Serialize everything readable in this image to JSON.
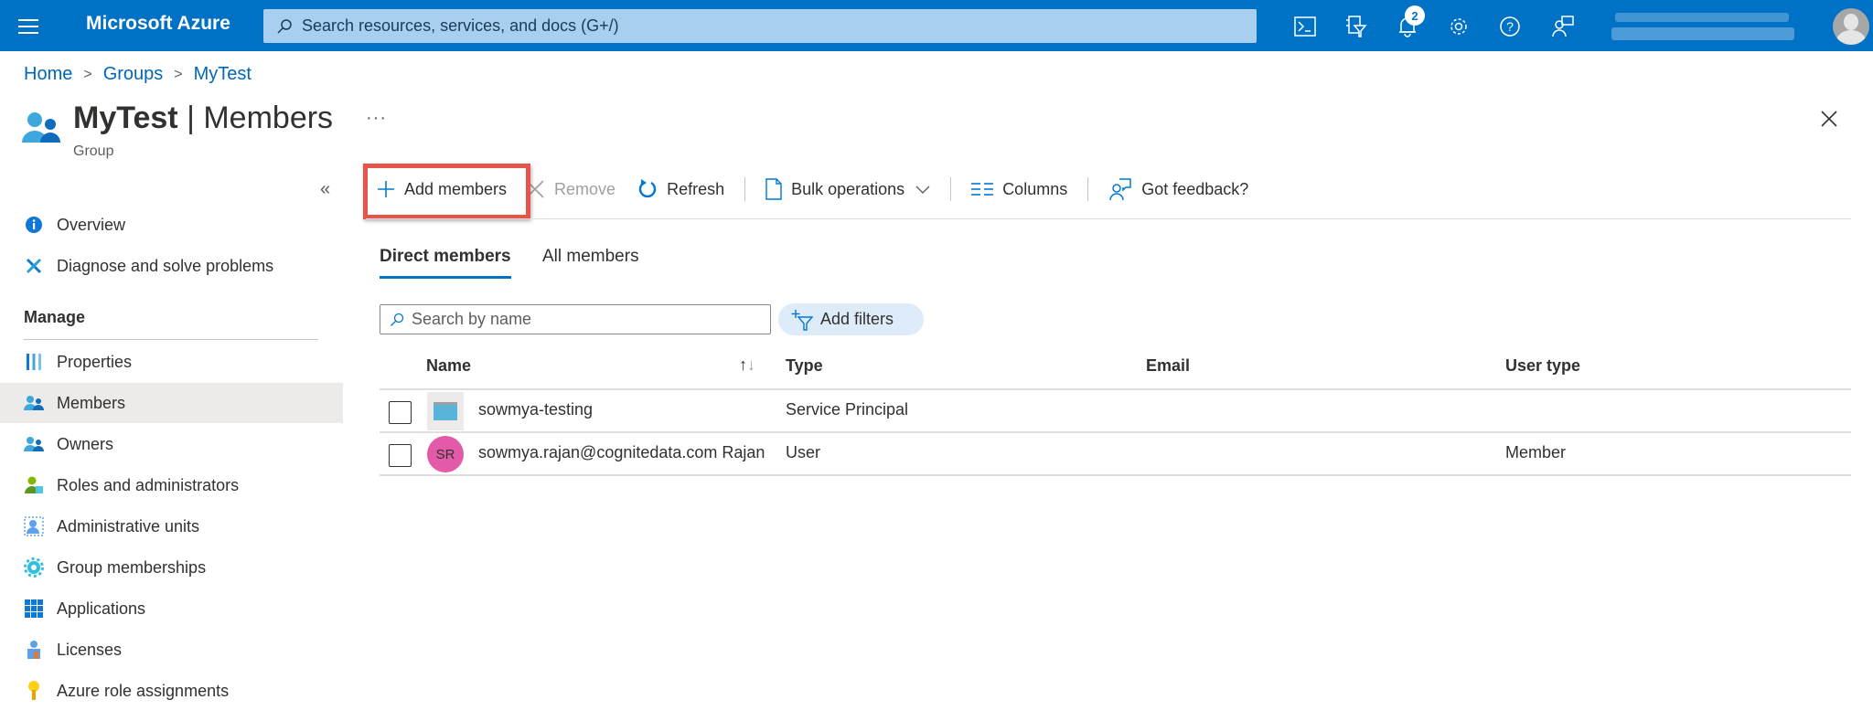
{
  "topbar": {
    "brand": "Microsoft Azure",
    "search_placeholder": "Search resources, services, and docs (G+/)",
    "notification_count": "2",
    "icons": [
      "cloud-shell-icon",
      "directory-filter-icon",
      "notifications-icon",
      "settings-icon",
      "help-icon",
      "feedback-icon"
    ]
  },
  "breadcrumb": [
    {
      "label": "Home"
    },
    {
      "label": "Groups"
    },
    {
      "label": "MyTest"
    }
  ],
  "header": {
    "title_strong": "MyTest",
    "title_rest": " | Members",
    "subtitle": "Group",
    "more_label": "···"
  },
  "sidebar": {
    "collapse_label": "«",
    "items_top": [
      {
        "label": "Overview",
        "icon": "info-icon"
      },
      {
        "label": "Diagnose and solve problems",
        "icon": "wrench-icon"
      }
    ],
    "section_label": "Manage",
    "items_manage": [
      {
        "label": "Properties",
        "icon": "properties-icon"
      },
      {
        "label": "Members",
        "icon": "members-icon",
        "active": true
      },
      {
        "label": "Owners",
        "icon": "owners-icon"
      },
      {
        "label": "Roles and administrators",
        "icon": "roles-icon"
      },
      {
        "label": "Administrative units",
        "icon": "admin-units-icon"
      },
      {
        "label": "Group memberships",
        "icon": "group-memberships-icon"
      },
      {
        "label": "Applications",
        "icon": "applications-icon"
      },
      {
        "label": "Licenses",
        "icon": "licenses-icon"
      },
      {
        "label": "Azure role assignments",
        "icon": "key-icon"
      }
    ]
  },
  "toolbar": {
    "add_members": "Add members",
    "remove": "Remove",
    "refresh": "Refresh",
    "bulk_operations": "Bulk operations",
    "columns": "Columns",
    "feedback": "Got feedback?"
  },
  "tabs": [
    {
      "label": "Direct members",
      "active": true
    },
    {
      "label": "All members",
      "active": false
    }
  ],
  "search": {
    "placeholder": "Search by name",
    "value": ""
  },
  "filter": {
    "label": "Add filters"
  },
  "table": {
    "columns": [
      "Name",
      "Type",
      "Email",
      "User type"
    ],
    "sort_label": "↑↓",
    "rows": [
      {
        "avatar_type": "service-principal",
        "initials": "",
        "name": "sowmya-testing",
        "type": "Service Principal",
        "email": "",
        "user_type": ""
      },
      {
        "avatar_type": "user",
        "initials": "SR",
        "name": "sowmya.rajan@cognitedata.com Rajan",
        "type": "User",
        "email": "",
        "user_type": "Member"
      }
    ]
  },
  "colors": {
    "brand": "#0072c6",
    "highlight": "#e8544a",
    "user_avatar": "#e25aa8"
  }
}
